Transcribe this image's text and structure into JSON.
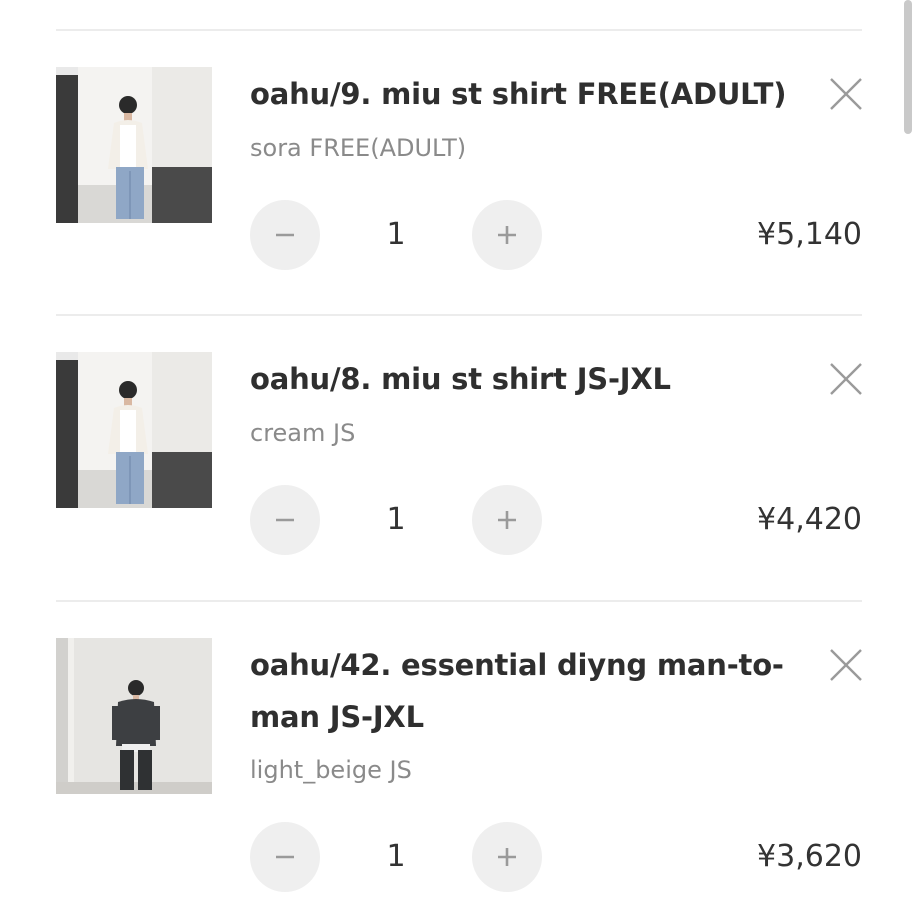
{
  "items": [
    {
      "title": "oahu/9. miu st shirt FREE(ADULT)",
      "variant": "sora FREE(ADULT)",
      "quantity": "1",
      "price": "¥5,140",
      "thumb_icon": "product-photo-white-shirt"
    },
    {
      "title": "oahu/8. miu st shirt JS-JXL",
      "variant": "cream JS",
      "quantity": "1",
      "price": "¥4,420",
      "thumb_icon": "product-photo-white-shirt"
    },
    {
      "title": "oahu/42. essential diyng man-to-man JS-JXL",
      "variant": "light_beige JS",
      "quantity": "1",
      "price": "¥3,620",
      "thumb_icon": "product-photo-dark-sweatshirt"
    }
  ],
  "icons": {
    "remove": "close-icon",
    "decrement": "minus-icon",
    "increment": "plus-icon"
  },
  "colors": {
    "stepper_bg": "#efefef",
    "icon_gray": "#9a9a9a",
    "divider": "#ececec",
    "title_text": "#2f2f2f",
    "variant_text": "#8a8a8a"
  }
}
